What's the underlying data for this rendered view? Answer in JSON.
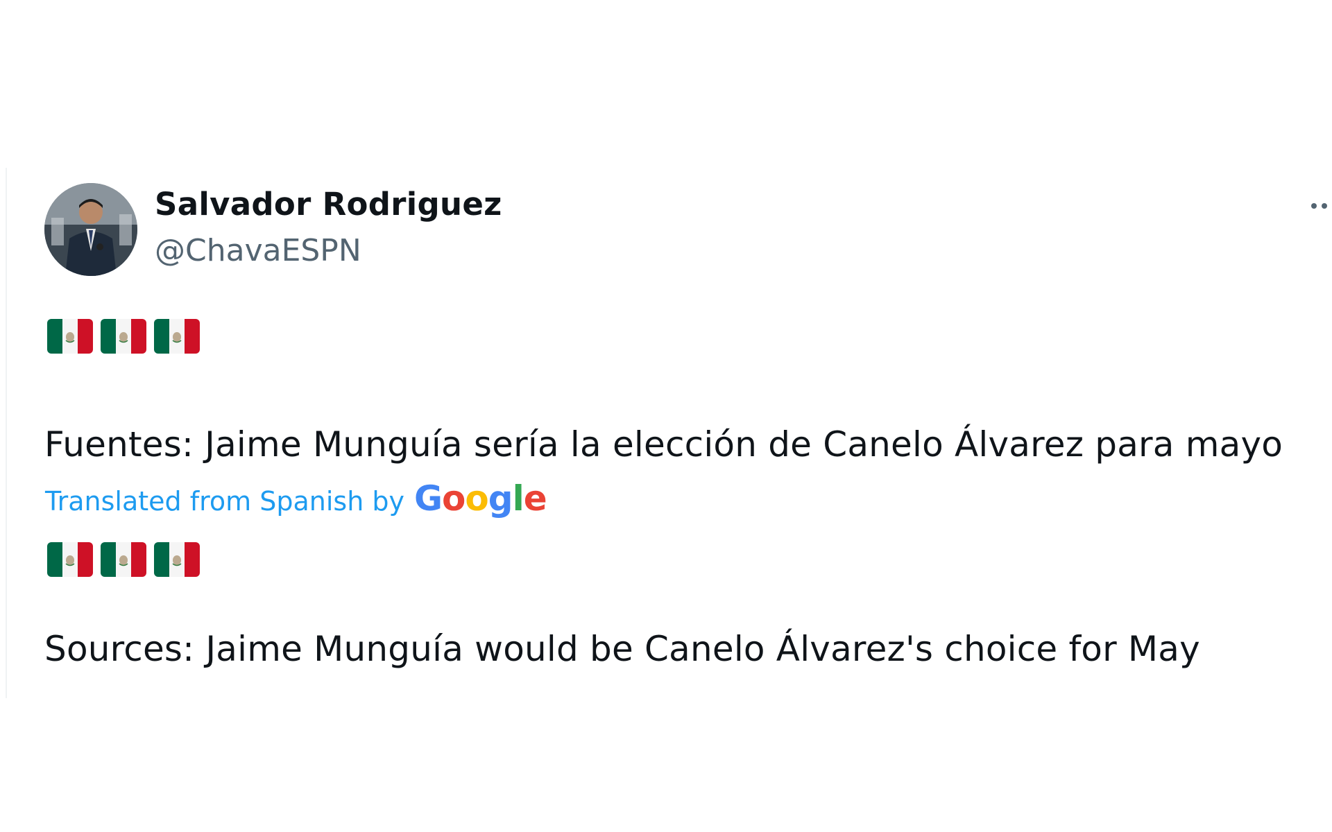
{
  "tweet": {
    "author": {
      "display_name": "Salvador Rodriguez",
      "handle": "@ChavaESPN"
    },
    "flag_emoji": "mexico-flag",
    "flags_count_per_row": 3,
    "original_text": "Fuentes: Jaime Munguía sería la elección de Canelo Álvarez para mayo",
    "translation_note": "Translated from Spanish by",
    "translation_provider": {
      "letters": [
        "G",
        "o",
        "o",
        "g",
        "l",
        "e"
      ]
    },
    "translated_text": "Sources: Jaime Munguía would be Canelo Álvarez's choice for May",
    "more_icon": "more-icon"
  },
  "colors": {
    "text_primary": "#0f1419",
    "text_secondary": "#536471",
    "link_blue": "#1d9bf0",
    "flag_green": "#006847",
    "flag_red": "#ce1126"
  }
}
